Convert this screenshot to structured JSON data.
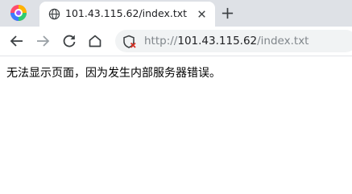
{
  "browser": {
    "logo_icon": "browser-logo-icon"
  },
  "tab": {
    "favicon": "globe-icon",
    "title": "101.43.115.62/index.txt",
    "close_icon": "close-icon"
  },
  "new_tab_icon": "plus-icon",
  "toolbar": {
    "back_icon": "back-arrow-icon",
    "forward_icon": "forward-arrow-icon",
    "reload_icon": "reload-icon",
    "home_icon": "home-icon",
    "security_icon": "not-secure-shield-icon"
  },
  "address_bar": {
    "scheme": "http://",
    "host": "101.43.115.62",
    "path": "/index.txt"
  },
  "page": {
    "error_message": "无法显示页面，因为发生内部服务器错误。"
  },
  "colors": {
    "tabstrip_bg": "#dee1e6",
    "omnibox_bg": "#f1f3f4",
    "security_warning": "#d93025"
  }
}
